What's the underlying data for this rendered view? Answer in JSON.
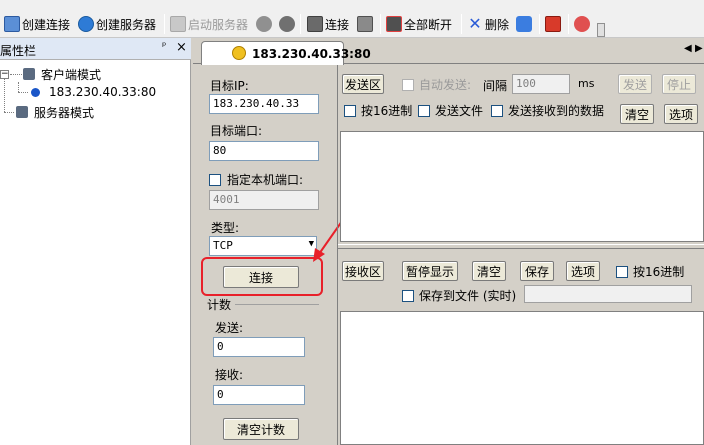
{
  "toolbar": {
    "new_connection": "创建连接",
    "new_server": "创建服务器",
    "start_server": "启动服务器",
    "connect": "连接",
    "disconnect_all": "全部断开",
    "delete": "删除"
  },
  "left_panel": {
    "title": "属性栏",
    "pin": "ᵖ",
    "close": "×",
    "tree": [
      {
        "label": "客户端模式"
      },
      {
        "label": "183.230.40.33:80"
      },
      {
        "label": "服务器模式"
      }
    ]
  },
  "tab": {
    "label": "183.230.40.33:80"
  },
  "settings": {
    "target_ip_label": "目标IP:",
    "target_ip_value": "183.230.40.33",
    "target_port_label": "目标端口:",
    "target_port_value": "80",
    "local_port_label": "指定本机端口:",
    "local_port_value": "4001",
    "type_label": "类型:",
    "type_value": "TCP",
    "connect_button": "连接",
    "count_label": "计数",
    "send_label": "发送:",
    "send_value": "0",
    "recv_label": "接收:",
    "recv_value": "0",
    "clear_count_button": "清空计数"
  },
  "send_area": {
    "title": "发送区",
    "auto_send": "自动发送:",
    "interval_label": "间隔",
    "interval_value": "100",
    "interval_unit": "ms",
    "send_button": "发送",
    "stop_button": "停止",
    "hex_label": "按16进制",
    "send_file_label": "发送文件",
    "send_received_label": "发送接收到的数据",
    "clear_button": "清空",
    "options_button": "选项"
  },
  "recv_area": {
    "title": "接收区",
    "pause_button": "暂停显示",
    "clear_button": "清空",
    "save_button": "保存",
    "options_button": "选项",
    "hex_label": "按16进制",
    "save_to_file_label": "保存到文件 (实时)"
  },
  "colors": {
    "annotation": "#e8202a",
    "accent": "#1c5180"
  }
}
